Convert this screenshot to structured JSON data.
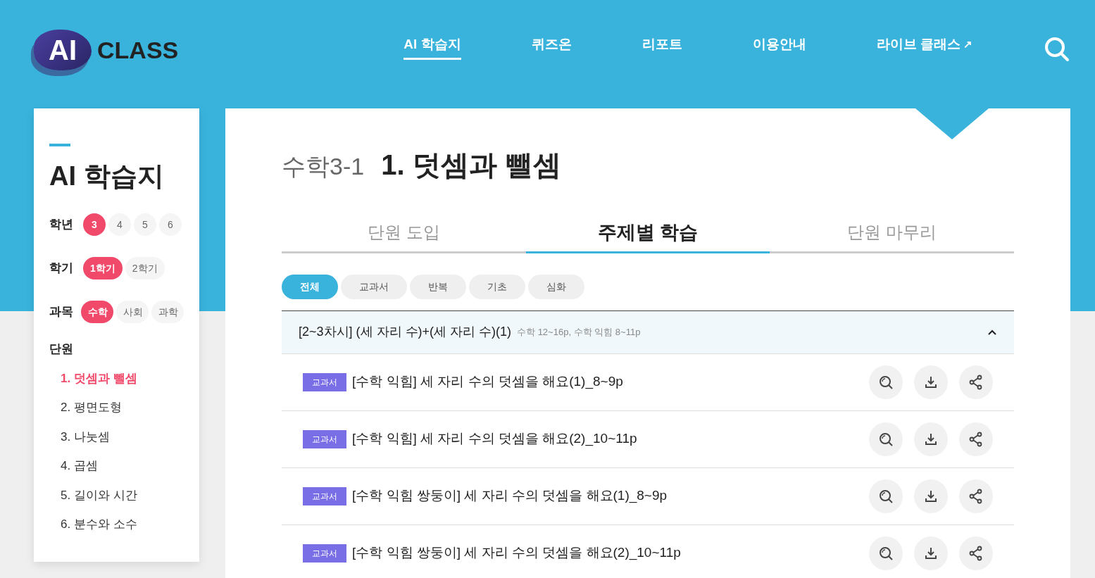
{
  "logo": {
    "badge": "AI",
    "text": "CLASS"
  },
  "nav": [
    {
      "label": "AI 학습지",
      "selected": true,
      "external": false
    },
    {
      "label": "퀴즈온",
      "selected": false,
      "external": false
    },
    {
      "label": "리포트",
      "selected": false,
      "external": false
    },
    {
      "label": "이용안내",
      "selected": false,
      "external": false
    },
    {
      "label": "라이브 클래스",
      "selected": false,
      "external": true,
      "mark": "↗"
    }
  ],
  "sidebar": {
    "title": "AI 학습지",
    "filters": [
      {
        "label": "학년",
        "options": [
          {
            "label": "3",
            "selected": true
          },
          {
            "label": "4",
            "selected": false
          },
          {
            "label": "5",
            "selected": false
          },
          {
            "label": "6",
            "selected": false
          }
        ]
      },
      {
        "label": "학기",
        "options": [
          {
            "label": "1학기",
            "selected": true
          },
          {
            "label": "2학기",
            "selected": false
          }
        ]
      },
      {
        "label": "과목",
        "options": [
          {
            "label": "수학",
            "selected": true
          },
          {
            "label": "사회",
            "selected": false
          },
          {
            "label": "과학",
            "selected": false
          }
        ]
      }
    ],
    "units_label": "단원",
    "units": [
      {
        "label": "1. 덧셈과 뺄셈",
        "selected": true
      },
      {
        "label": "2. 평면도형",
        "selected": false
      },
      {
        "label": "3. 나눗셈",
        "selected": false
      },
      {
        "label": "4. 곱셈",
        "selected": false
      },
      {
        "label": "5. 길이와 시간",
        "selected": false
      },
      {
        "label": "6. 분수와 소수",
        "selected": false
      }
    ]
  },
  "heading": {
    "subject": "수학3-1",
    "unit": "1. 덧셈과 뺄셈"
  },
  "tabs": [
    {
      "label": "단원 도입",
      "selected": false
    },
    {
      "label": "주제별 학습",
      "selected": true
    },
    {
      "label": "단원 마무리",
      "selected": false
    }
  ],
  "chips": [
    {
      "label": "전체",
      "selected": true
    },
    {
      "label": "교과서",
      "selected": false
    },
    {
      "label": "반복",
      "selected": false
    },
    {
      "label": "기초",
      "selected": false
    },
    {
      "label": "심화",
      "selected": false
    }
  ],
  "section": {
    "title": "[2~3차시] (세 자리 수)+(세 자리 수)(1)",
    "pages": "수학 12~16p, 수학 익힘 8~11p",
    "expanded": true,
    "items": [
      {
        "tag": "교과서",
        "title": "[수학 익힘] 세 자리 수의 덧셈을 해요(1)_8~9p"
      },
      {
        "tag": "교과서",
        "title": "[수학 익힘] 세 자리 수의 덧셈을 해요(2)_10~11p"
      },
      {
        "tag": "교과서",
        "title": "[수학 익힘 쌍둥이] 세 자리 수의 덧셈을 해요(1)_8~9p"
      },
      {
        "tag": "교과서",
        "title": "[수학 익힘 쌍둥이] 세 자리 수의 덧셈을 해요(2)_10~11p"
      }
    ]
  }
}
